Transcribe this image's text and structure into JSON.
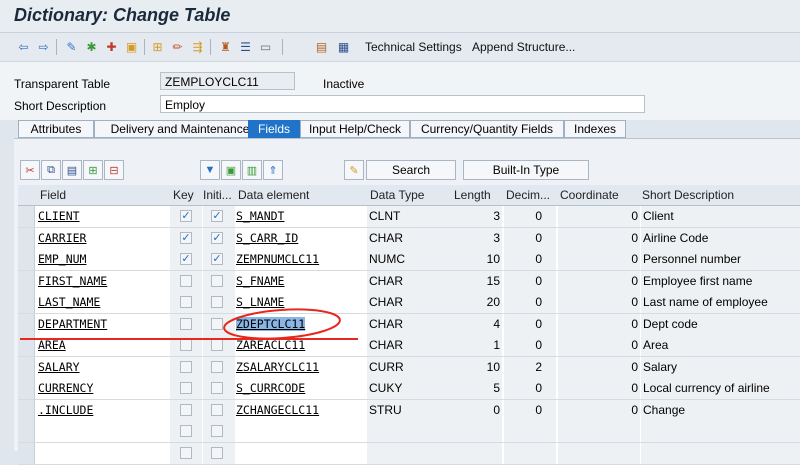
{
  "window": {
    "title": "Dictionary: Change Table"
  },
  "toolbar": {
    "technical_settings": "Technical Settings",
    "append_structure": "Append Structure..."
  },
  "header": {
    "table_type_label": "Transparent Table",
    "table_name": "ZEMPLOYCLC11",
    "status": "Inactive",
    "short_desc_label": "Short Description",
    "short_desc_value": "Employ"
  },
  "tabs": [
    "Attributes",
    "Delivery and Maintenance",
    "Fields",
    "Input Help/Check",
    "Currency/Quantity Fields",
    "Indexes"
  ],
  "active_tab": "Fields",
  "buttons": {
    "search": "Search",
    "builtin_type": "Built-In Type"
  },
  "columns": [
    "Field",
    "Key",
    "Initi...",
    "Data element",
    "Data Type",
    "Length",
    "Decim...",
    "Coordinate",
    "Short Description"
  ],
  "rows": [
    {
      "field": "CLIENT",
      "key": true,
      "init": true,
      "element": "S_MANDT",
      "type": "CLNT",
      "length": "3",
      "dec": "0",
      "coord": "0",
      "desc": "Client"
    },
    {
      "field": "CARRIER",
      "key": true,
      "init": true,
      "element": "S_CARR_ID",
      "type": "CHAR",
      "length": "3",
      "dec": "0",
      "coord": "0",
      "desc": "Airline Code"
    },
    {
      "field": "EMP_NUM",
      "key": true,
      "init": true,
      "element": "ZEMPNUMCLC11",
      "type": "NUMC",
      "length": "10",
      "dec": "0",
      "coord": "0",
      "desc": "Personnel number"
    },
    {
      "field": "FIRST_NAME",
      "key": false,
      "init": false,
      "element": "S_FNAME",
      "type": "CHAR",
      "length": "15",
      "dec": "0",
      "coord": "0",
      "desc": "Employee first name"
    },
    {
      "field": "LAST_NAME",
      "key": false,
      "init": false,
      "element": "S_LNAME",
      "type": "CHAR",
      "length": "20",
      "dec": "0",
      "coord": "0",
      "desc": "Last name of employee"
    },
    {
      "field": "DEPARTMENT",
      "key": false,
      "init": false,
      "element": "ZDEPTCLC11",
      "type": "CHAR",
      "length": "4",
      "dec": "0",
      "coord": "0",
      "desc": "Dept code"
    },
    {
      "field": "AREA",
      "key": false,
      "init": false,
      "element": "ZAREACLC11",
      "type": "CHAR",
      "length": "1",
      "dec": "0",
      "coord": "0",
      "desc": "Area"
    },
    {
      "field": "SALARY",
      "key": false,
      "init": false,
      "element": "ZSALARYCLC11",
      "type": "CURR",
      "length": "10",
      "dec": "2",
      "coord": "0",
      "desc": "Salary"
    },
    {
      "field": "CURRENCY",
      "key": false,
      "init": false,
      "element": "S_CURRCODE",
      "type": "CUKY",
      "length": "5",
      "dec": "0",
      "coord": "0",
      "desc": "Local currency of airline"
    },
    {
      "field": ".INCLUDE",
      "key": false,
      "init": false,
      "element": "ZCHANGECLC11",
      "type": "STRU",
      "length": "0",
      "dec": "0",
      "coord": "0",
      "desc": "Change"
    },
    {
      "field": "",
      "key": false,
      "init": false,
      "element": "",
      "type": "",
      "length": "",
      "dec": "",
      "coord": "",
      "desc": ""
    },
    {
      "field": "",
      "key": false,
      "init": false,
      "element": "",
      "type": "",
      "length": "",
      "dec": "",
      "coord": "",
      "desc": ""
    }
  ],
  "highlighted_row": 5,
  "colors": {
    "accent": "#1f73c9",
    "annotation": "#e8281e",
    "highlight": "#8ab6e6",
    "check": "#1f6fc4"
  }
}
